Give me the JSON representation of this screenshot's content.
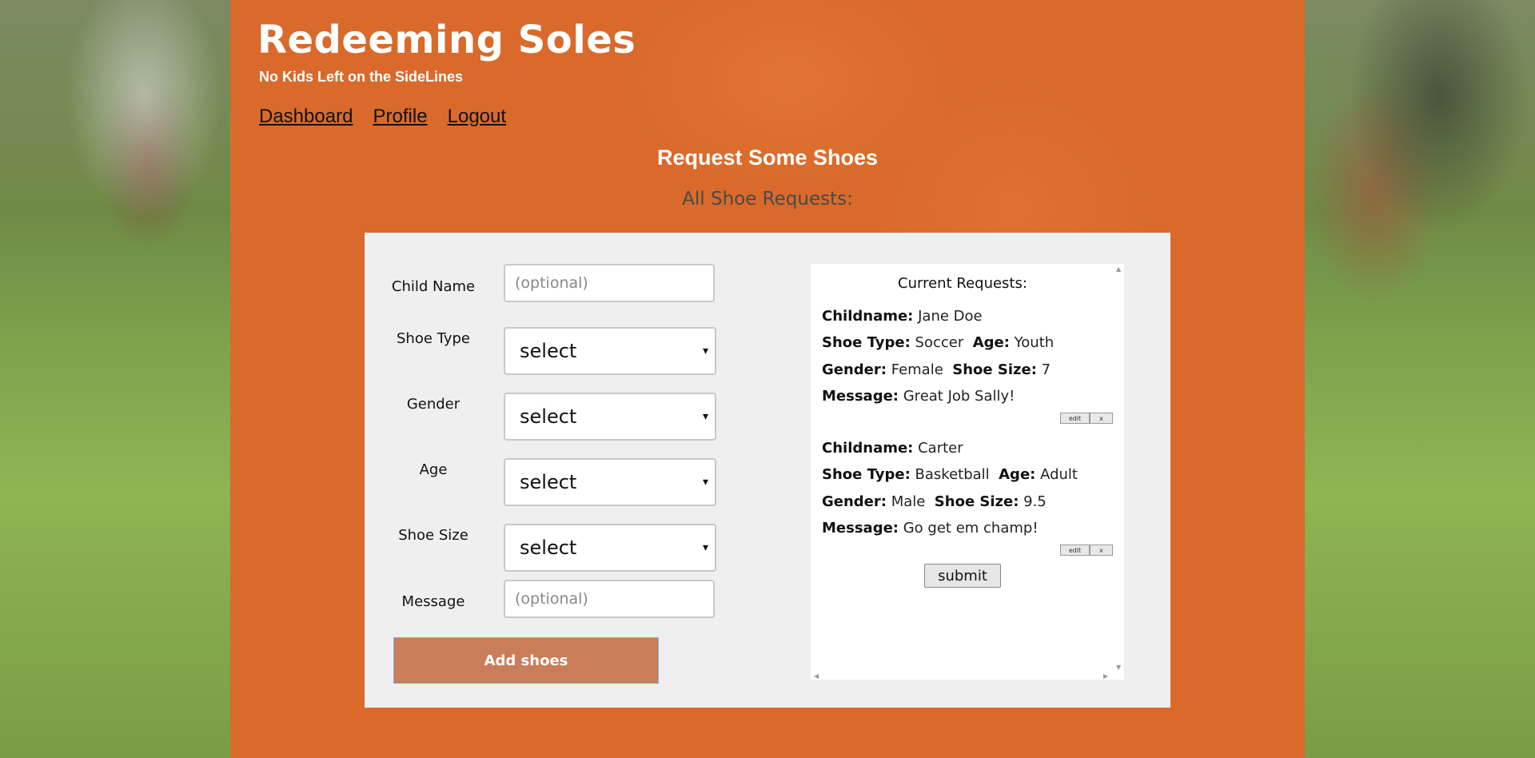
{
  "brand": {
    "title": "Redeeming Soles",
    "subtitle": "No Kids Left on the SideLines"
  },
  "nav": {
    "items": [
      {
        "label": "Dashboard"
      },
      {
        "label": "Profile"
      },
      {
        "label": "Logout"
      }
    ]
  },
  "page": {
    "heading": "Request Some Shoes",
    "subheading": "All Shoe Requests:"
  },
  "form": {
    "child_name": {
      "label": "Child Name",
      "placeholder": "(optional)",
      "value": ""
    },
    "shoe_type": {
      "label": "Shoe Type",
      "selected": "select"
    },
    "gender": {
      "label": "Gender",
      "selected": "select"
    },
    "age": {
      "label": "Age",
      "selected": "select"
    },
    "shoe_size": {
      "label": "Shoe Size",
      "selected": "select"
    },
    "message": {
      "label": "Message",
      "placeholder": "(optional)",
      "value": ""
    },
    "add_button": "Add shoes"
  },
  "requests": {
    "title": "Current Requests:",
    "labels": {
      "childname": "Childname:",
      "shoe_type": "Shoe Type:",
      "age": "Age:",
      "gender": "Gender:",
      "shoe_size": "Shoe Size:",
      "message": "Message:"
    },
    "items": [
      {
        "childname": "Jane Doe",
        "shoe_type": "Soccer",
        "age": "Youth",
        "gender": "Female",
        "shoe_size": "7",
        "message": "Great Job Sally!"
      },
      {
        "childname": "Carter",
        "shoe_type": "Basketball",
        "age": "Adult",
        "gender": "Male",
        "shoe_size": "9.5",
        "message": "Go get em champ!"
      }
    ],
    "edit_label": "edit",
    "delete_label": "x",
    "submit_label": "submit"
  },
  "icons": {
    "caret": "▾",
    "scroll_up": "▲",
    "scroll_down": "▼",
    "scroll_left": "◀",
    "scroll_right": "▶"
  },
  "colors": {
    "panel": "#d96a2b",
    "card": "#efefef",
    "add_button": "#c97d58",
    "subheading": "#4a4a4a"
  }
}
